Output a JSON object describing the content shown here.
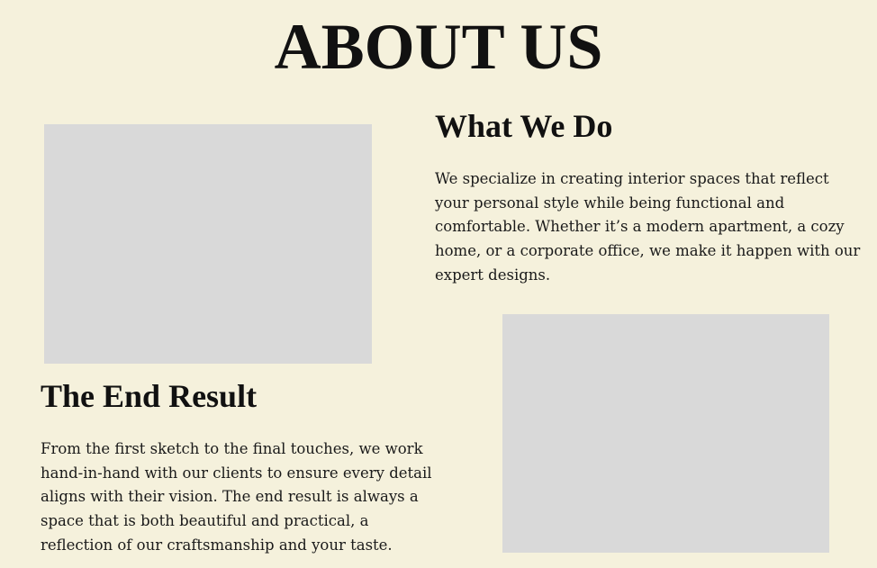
{
  "header": {
    "title": "ABOUT US"
  },
  "sections": [
    {
      "heading": "What We Do",
      "body": "We specialize in creating interior spaces that reflect your personal style while being functional and comfortable. Whether it’s a modern apartment, a cozy home, or a corporate office, we make it happen with our expert designs."
    },
    {
      "heading": "The End Result",
      "body": "From the first sketch to the final touches, we work hand-in-hand with our clients to ensure every detail aligns with their vision. The end result is always a space that is both beautiful and practical, a reflection of our craftsmanship and your taste."
    }
  ],
  "colors": {
    "background": "#f5f1dc",
    "image_placeholder": "#d9d9d9",
    "text": "#111111"
  }
}
